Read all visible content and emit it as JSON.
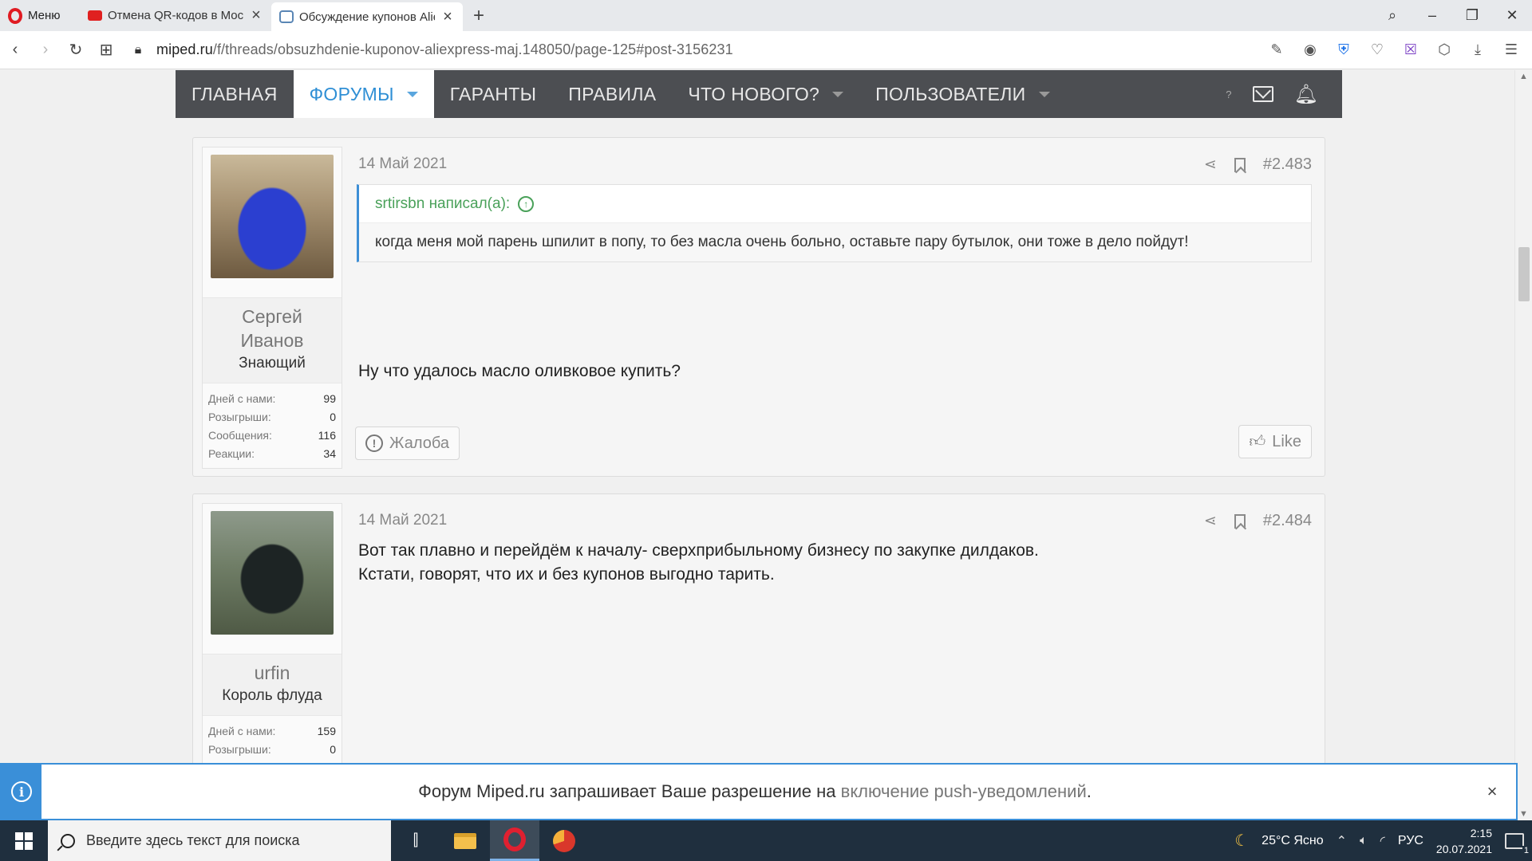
{
  "browser": {
    "menu_label": "Меню",
    "tabs": [
      {
        "title": "Отмена QR-кодов в Моск",
        "favicon": "youtube-icon",
        "active": false
      },
      {
        "title": "Обсуждение купонов Alie",
        "favicon": "forum-icon",
        "active": true
      }
    ],
    "new_tab": "+",
    "address": {
      "domain": "miped.ru",
      "path": "/f/threads/obsuzhdenie-kuponov-aliexpress-maj.148050/page-125#post-3156231"
    }
  },
  "navbar": {
    "items": [
      {
        "label": "ГЛАВНАЯ",
        "active": false,
        "has_menu": false
      },
      {
        "label": "ФОРУМЫ",
        "active": true,
        "has_menu": true
      },
      {
        "label": "ГАРАНТЫ",
        "active": false,
        "has_menu": false
      },
      {
        "label": "ПРАВИЛА",
        "active": false,
        "has_menu": false
      },
      {
        "label": "ЧТО НОВОГО?",
        "active": false,
        "has_menu": true
      },
      {
        "label": "ПОЛЬЗОВАТЕЛИ",
        "active": false,
        "has_menu": true
      }
    ],
    "help_label": "?",
    "accent_color": "#2f8fd5",
    "bar_color": "#4c4e52"
  },
  "posts": [
    {
      "user": {
        "name": "Сергей Иванов",
        "title": "Знающий",
        "stats": [
          {
            "label": "Дней с нами:",
            "value": "99"
          },
          {
            "label": "Розыгрыши:",
            "value": "0"
          },
          {
            "label": "Сообщения:",
            "value": "116"
          },
          {
            "label": "Реакции:",
            "value": "34"
          }
        ]
      },
      "date": "14 Май 2021",
      "number": "#2.483",
      "quote": {
        "author_line": "srtirsbn написал(а):",
        "text": "когда меня мой парень шпилит в попу, то без масла очень больно, оставьте пару бутылок, они тоже в дело пойдут!"
      },
      "text": "Ну что удалось масло оливковое купить?",
      "report_label": "Жалоба",
      "like_label": "Like"
    },
    {
      "user": {
        "name": "urfin",
        "title": "Король флуда",
        "stats": [
          {
            "label": "Дней с нами:",
            "value": "159"
          },
          {
            "label": "Розыгрыши:",
            "value": "0"
          }
        ]
      },
      "date": "14 Май 2021",
      "number": "#2.484",
      "text_lines": [
        "Вот так плавно и перейдём к началу- сверхприбыльному бизнесу по закупке дилдаков.",
        "Кстати, говорят, что их и без купонов выгодно тарить."
      ]
    }
  ],
  "push_bar": {
    "text_before": "Форум Miped.ru запрашивает Ваше разрешение на ",
    "link_text": "включение push-уведомлений",
    "text_after": ".",
    "close": "×",
    "accent_color": "#3a8fd8"
  },
  "taskbar": {
    "search_placeholder": "Введите здесь текст для поиска",
    "weather": "25°C Ясно",
    "language": "РУС",
    "time": "2:15",
    "date": "20.07.2021",
    "notification_count": "1"
  }
}
